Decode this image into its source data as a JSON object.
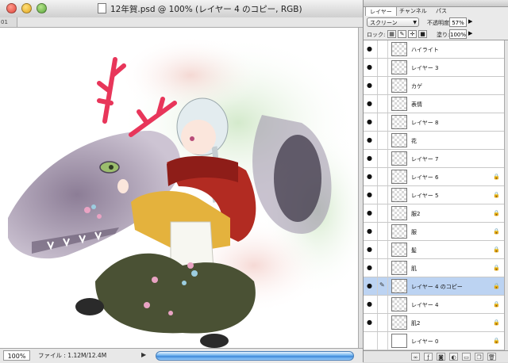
{
  "window": {
    "title": "12年賀.psd @ 100% (レイヤー 4 のコピー, RGB)",
    "ruler_corner": "01 02"
  },
  "status": {
    "zoom": "100%",
    "file_info": "ファイル : 1.12M/12.4M",
    "arrow": "▶"
  },
  "layers_panel": {
    "tabs": [
      {
        "label": "レイヤー",
        "active": true
      },
      {
        "label": "チャンネル",
        "active": false
      },
      {
        "label": "パス",
        "active": false
      }
    ],
    "blend_mode": "スクリーン",
    "opacity_label": "不透明度:",
    "opacity_value": "57%",
    "lock_label": "ロック:",
    "fill_label": "塗り:",
    "fill_value": "100%",
    "layers": [
      {
        "name": "ハイライト",
        "visible": true,
        "locked": false,
        "selected": false
      },
      {
        "name": "レイヤー 3",
        "visible": true,
        "locked": false,
        "selected": false
      },
      {
        "name": "カゲ",
        "visible": true,
        "locked": false,
        "selected": false
      },
      {
        "name": "表情",
        "visible": true,
        "locked": false,
        "selected": false
      },
      {
        "name": "レイヤー 8",
        "visible": true,
        "locked": false,
        "selected": false
      },
      {
        "name": "花",
        "visible": true,
        "locked": false,
        "selected": false
      },
      {
        "name": "レイヤー 7",
        "visible": true,
        "locked": false,
        "selected": false
      },
      {
        "name": "レイヤー 6",
        "visible": true,
        "locked": true,
        "selected": false
      },
      {
        "name": "レイヤー 5",
        "visible": true,
        "locked": true,
        "selected": false
      },
      {
        "name": "服2",
        "visible": true,
        "locked": true,
        "selected": false
      },
      {
        "name": "服",
        "visible": true,
        "locked": true,
        "selected": false
      },
      {
        "name": "髪",
        "visible": true,
        "locked": true,
        "selected": false
      },
      {
        "name": "肌",
        "visible": true,
        "locked": true,
        "selected": false
      },
      {
        "name": "レイヤー 4 のコピー",
        "visible": true,
        "locked": true,
        "selected": true
      },
      {
        "name": "レイヤー 4",
        "visible": true,
        "locked": true,
        "selected": false
      },
      {
        "name": "肌2",
        "visible": true,
        "locked": true,
        "selected": false
      },
      {
        "name": "レイヤー 0",
        "visible": false,
        "locked": true,
        "selected": false
      }
    ]
  },
  "colors": {
    "selection": "#bcd3f2",
    "scroll_blue": "#3d88d8",
    "antler": "#e8365a"
  }
}
